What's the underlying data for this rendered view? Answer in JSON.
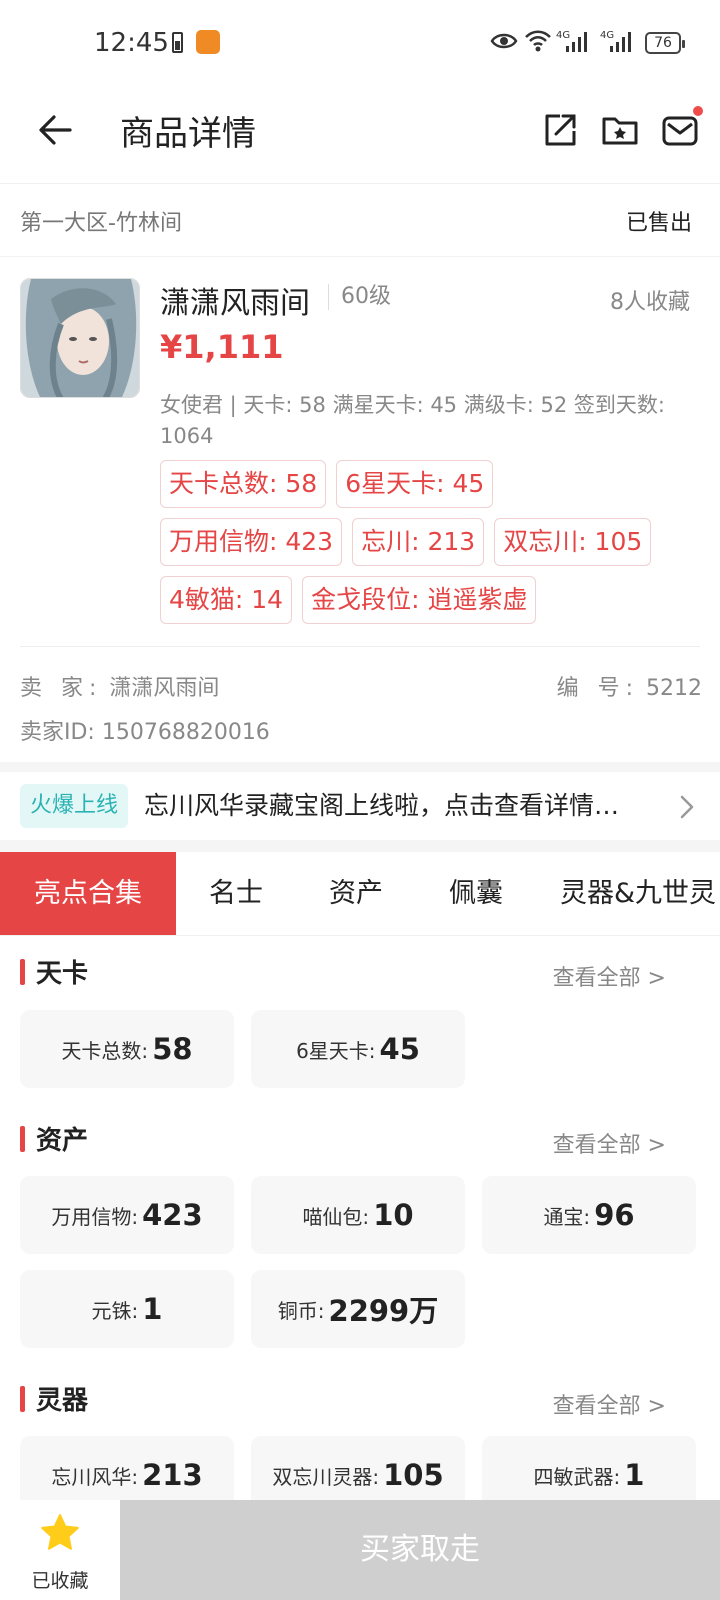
{
  "status_bar": {
    "time": "12:45",
    "battery": "76",
    "network1": "4G",
    "network2": "4G"
  },
  "header": {
    "title": "商品详情"
  },
  "server_row": {
    "server": "第一大区-竹林间",
    "status": "已售出"
  },
  "product": {
    "name": "潇潇风雨间",
    "level": "60级",
    "favorites": "8人收藏",
    "price": "¥1,111",
    "description": "女使君 | 天卡: 58 满星天卡: 45 满级卡: 52 签到天数: 1064",
    "tags": [
      [
        "天卡总数: 58",
        "6星天卡: 45"
      ],
      [
        "万用信物: 423",
        "忘川: 213",
        "双忘川: 105"
      ],
      [
        "4敏猫: 14",
        "金戈段位: 逍遥紫虚"
      ]
    ]
  },
  "seller": {
    "seller_label": "卖 家:",
    "seller_name": "潇潇风雨间",
    "serial_label": "编 号:",
    "serial_value": "5212",
    "id_label": "卖家ID:",
    "id_value": "150768820016"
  },
  "banner": {
    "badge": "火爆上线",
    "text": "忘川风华录藏宝阁上线啦，点击查看详情…"
  },
  "tabs": [
    "亮点合集",
    "名士",
    "资产",
    "佩囊",
    "灵器&九世灵"
  ],
  "sections": [
    {
      "title": "天卡",
      "see_all": "查看全部 >",
      "cards": [
        {
          "k": "天卡总数:",
          "v": "58"
        },
        {
          "k": "6星天卡:",
          "v": "45"
        }
      ]
    },
    {
      "title": "资产",
      "see_all": "查看全部 >",
      "cards": [
        {
          "k": "万用信物:",
          "v": "423"
        },
        {
          "k": "喵仙包:",
          "v": "10"
        },
        {
          "k": "通宝:",
          "v": "96"
        },
        {
          "k": "元铢:",
          "v": "1"
        },
        {
          "k": "铜币:",
          "v": "2299万"
        }
      ]
    },
    {
      "title": "灵器",
      "see_all": "查看全部 >",
      "cards": [
        {
          "k": "忘川风华:",
          "v": "213"
        },
        {
          "k": "双忘川灵器:",
          "v": "105"
        },
        {
          "k": "四敏武器:",
          "v": "1"
        }
      ]
    }
  ],
  "bottom": {
    "fav_label": "已收藏",
    "buy_label": "买家取走"
  },
  "colors": {
    "accent": "#e64545",
    "hot_badge_bg": "#e4f7f7",
    "hot_badge_text": "#2bb3b3",
    "buy_disabled": "#cfcfcf",
    "star": "#ffcc1a"
  }
}
